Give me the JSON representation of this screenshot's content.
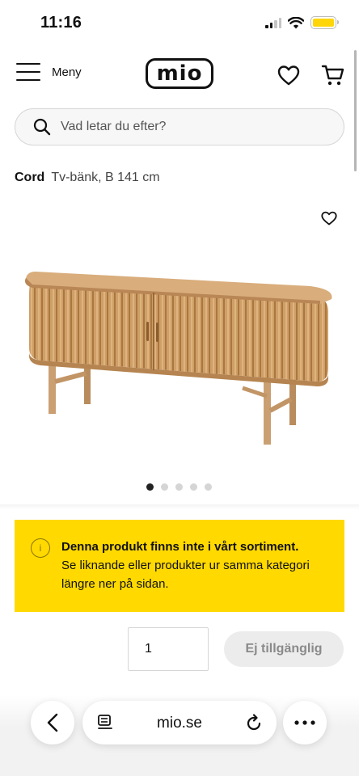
{
  "status_bar": {
    "time": "11:16"
  },
  "header": {
    "menu_label": "Meny",
    "logo_text": "mio"
  },
  "search": {
    "placeholder": "Vad letar du efter?"
  },
  "product": {
    "brand": "Cord",
    "description": "Tv-bänk, B 141 cm",
    "image_count": 5,
    "active_image": 1
  },
  "notice": {
    "title": "Denna produkt finns inte i vårt sortiment.",
    "body": "Se liknande eller produkter ur samma kategori längre ner på sidan.",
    "icon": "i"
  },
  "purchase": {
    "quantity": "1",
    "button_label": "Ej tillgänglig"
  },
  "browser": {
    "url": "mio.se"
  },
  "colors": {
    "notice_background": "#ffd900",
    "button_disabled_bg": "#ececec",
    "battery": "#ffd60a"
  }
}
